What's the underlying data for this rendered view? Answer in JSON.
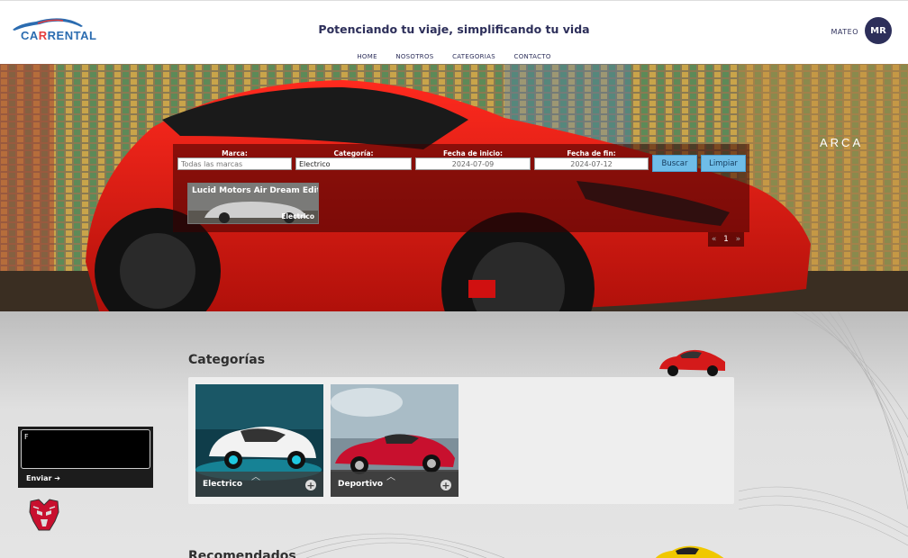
{
  "header": {
    "logo_text_a": "CA",
    "logo_text_r": "R",
    "logo_text_b": "RENTAL",
    "slogan": "Potenciando tu viaje, simplificando tu vida",
    "nav": [
      "HOME",
      "NOSOTROS",
      "CATEGORIAS",
      "CONTACTO"
    ],
    "user_name": "MATEO",
    "avatar_initials": "MR"
  },
  "search": {
    "brand_label": "Marca:",
    "brand_placeholder": "Todas las marcas",
    "category_label": "Categoría:",
    "category_value": "Electrico",
    "start_label": "Fecha de inicio:",
    "start_value": "2024-07-09",
    "end_label": "Fecha de fin:",
    "end_value": "2024-07-12",
    "search_button": "Buscar",
    "clear_button": "Limpiar"
  },
  "results": [
    {
      "title": "Lucid Motors Air Dream Edition",
      "category": "Electrico"
    }
  ],
  "pagination": {
    "prev": "«",
    "page": "1",
    "next": "»"
  },
  "categories": {
    "title": "Categorías",
    "items": [
      {
        "name": "Electrico",
        "action": "+"
      },
      {
        "name": "Deportivo",
        "action": "+"
      }
    ]
  },
  "recommended": {
    "title": "Recomendados"
  },
  "chat": {
    "input_value": "F",
    "send_label": "Enviar ➔"
  },
  "colors": {
    "brand_dark": "#2d2f5a",
    "button_blue": "#6fbde8",
    "logo_blue": "#2b6cb0",
    "logo_red": "#e53e3e"
  }
}
